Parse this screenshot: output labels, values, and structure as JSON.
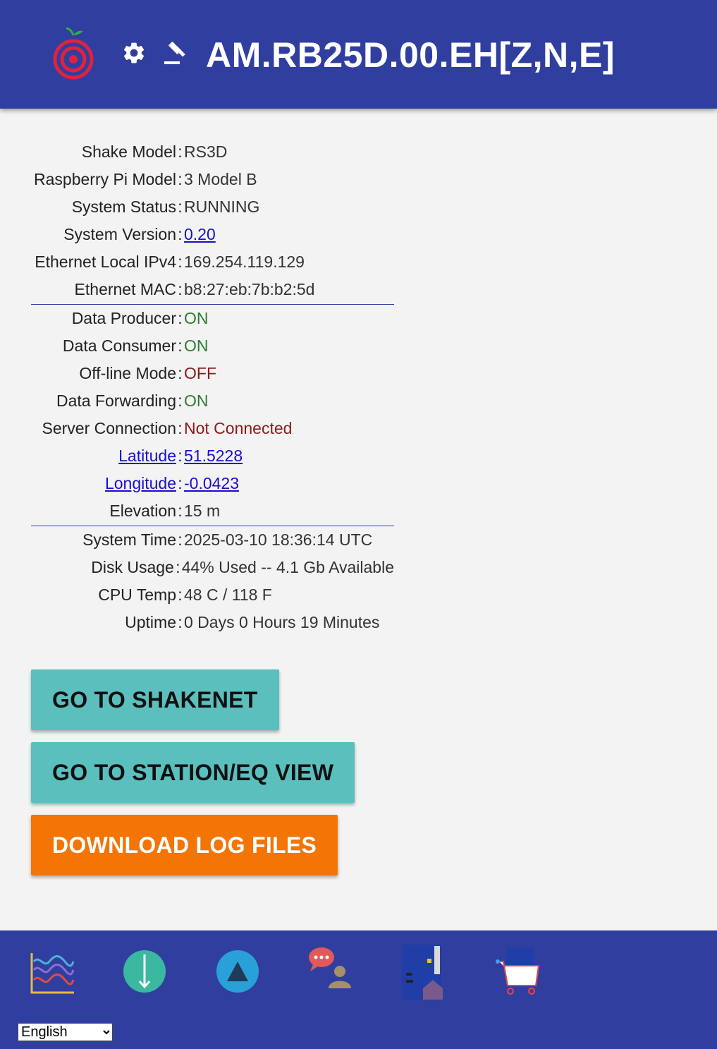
{
  "header": {
    "station_title": "AM.RB25D.00.EH[Z,N,E]",
    "icons": [
      "raspberry-shake-logo",
      "gear-icon",
      "gavel-icon"
    ]
  },
  "info": {
    "section1": [
      {
        "label": "Shake Model",
        "value": "RS3D"
      },
      {
        "label": "Raspberry Pi Model",
        "value": "3 Model B"
      },
      {
        "label": "System Status",
        "value": "RUNNING"
      },
      {
        "label": "System Version",
        "value": "0.20"
      },
      {
        "label": "Ethernet Local IPv4",
        "value": "169.254.119.129"
      },
      {
        "label": "Ethernet MAC",
        "value": "b8:27:eb:7b:b2:5d"
      }
    ],
    "section2": [
      {
        "label": "Data Producer",
        "value": "ON"
      },
      {
        "label": "Data Consumer",
        "value": "ON"
      },
      {
        "label": "Off-line Mode",
        "value": "OFF"
      },
      {
        "label": "Data Forwarding",
        "value": "ON"
      },
      {
        "label": "Server Connection",
        "value": "Not Connected"
      },
      {
        "label": "Latitude",
        "value": "51.5228"
      },
      {
        "label": "Longitude",
        "value": "-0.0423"
      },
      {
        "label": "Elevation",
        "value": "15 m"
      }
    ],
    "section3": [
      {
        "label": "System Time",
        "value": "2025-03-10 18:36:14 UTC"
      },
      {
        "label": "Disk Usage",
        "value": "44% Used -- 4.1 Gb Available"
      },
      {
        "label": "CPU Temp",
        "value": "48 C / 118 F"
      },
      {
        "label": "Uptime",
        "value": "0 Days 0 Hours 19 Minutes"
      }
    ],
    "separator": ":"
  },
  "buttons": {
    "shakenet": "GO TO SHAKENET",
    "station_eq_view": "GO TO STATION/EQ VIEW",
    "download_logs": "DOWNLOAD LOG FILES"
  },
  "footer": {
    "icons": [
      "waveform-chart-icon",
      "download-arrow-icon",
      "triangle-upload-icon",
      "community-chat-icon",
      "board-home-icon",
      "shop-cart-icon"
    ],
    "language_selected": "English"
  },
  "colors": {
    "primary": "#303f9f",
    "teal_button": "#5bbfbe",
    "orange_button": "#f27506",
    "status_on": "#2e7d32",
    "status_off": "#8b1a1a",
    "link": "#1a0dcc"
  }
}
